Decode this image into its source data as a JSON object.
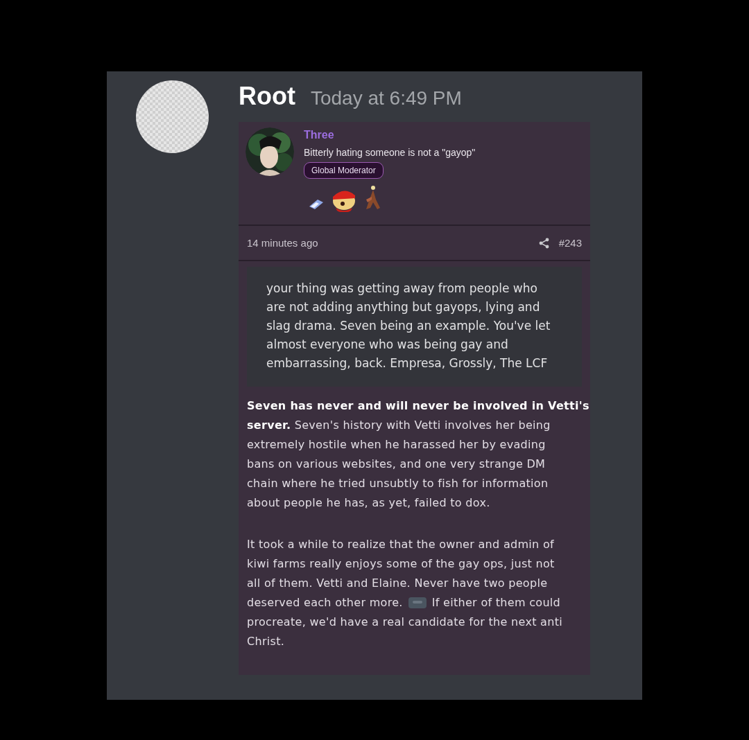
{
  "message": {
    "author": "Root",
    "timestamp": "Today at 6:49 PM"
  },
  "embed": {
    "author_name": "Three",
    "author_title": "Bitterly hating someone is not a \"gayop\"",
    "badge": "Global Moderator",
    "posted": "14 minutes ago",
    "post_number": "#243",
    "quote_lines": [
      "your thing was getting away from people who",
      "are not adding anything but gayops, lying and",
      "slag drama. Seven being an example. You've let",
      "almost everyone who was being gay and",
      "embarrassing, back. Empresa, Grossly, The LCF"
    ],
    "paragraphs": [
      {
        "lines": [
          {
            "parts": [
              "**Seven has never and will never be involved in Vetti's**"
            ]
          },
          {
            "parts": [
              "**server.** Seven's history with Vetti involves her being"
            ]
          },
          {
            "parts": [
              "extremely hostile when he harassed her by evading"
            ]
          },
          {
            "parts": [
              "bans on various websites, and one very strange DM"
            ]
          },
          {
            "parts": [
              "chain where he tried unsubtly to fish for information"
            ]
          },
          {
            "parts": [
              "about people he has, as yet, failed to dox."
            ]
          }
        ]
      },
      {
        "lines": [
          {
            "parts": [
              "It took a while to realize that the owner and admin of"
            ]
          },
          {
            "parts": [
              "kiwi farms really enjoys some of the gay ops, just not"
            ]
          },
          {
            "parts": [
              "all of them. Vetti and Elaine. Never have two people"
            ]
          },
          {
            "parts": [
              "deserved each other more.",
              "If either of them could"
            ]
          },
          {
            "parts": [
              "procreate, we'd have a real candidate for the next anti"
            ]
          },
          {
            "parts": [
              "Christ."
            ]
          }
        ]
      }
    ]
  }
}
